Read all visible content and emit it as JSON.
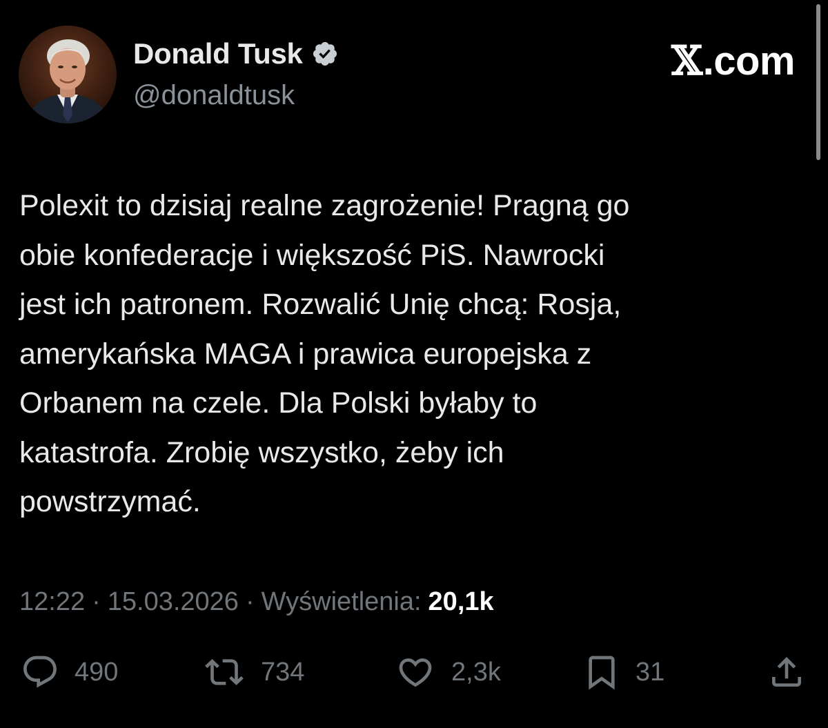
{
  "author": {
    "display_name": "Donald Tusk",
    "handle": "@donaldtusk",
    "verified_icon": "verified-badge-icon",
    "avatar": "profile-photo"
  },
  "brand": {
    "x_glyph": "𝕏",
    "domain": ".com"
  },
  "tweet": {
    "text": "Polexit to dzisiaj realne zagrożenie! Pragną go\nobie konfederacje i większość PiS. Nawrocki\njest ich patronem. Rozwalić Unię chcą: Rosja,\namerykańska MAGA i prawica europejska z\nOrbanem na czele. Dla Polski byłaby to\nkatastrofa. Zrobię wszystko, żeby ich\npowstrzymać."
  },
  "meta": {
    "time": "12:22",
    "separator": "·",
    "date": "15.03.2026",
    "views_label": "Wyświetlenia:",
    "views_count": "20,1k"
  },
  "actions": {
    "replies": {
      "icon": "reply-icon",
      "count": "490"
    },
    "reposts": {
      "icon": "repost-icon",
      "count": "734"
    },
    "likes": {
      "icon": "heart-icon",
      "count": "2,3k"
    },
    "bookmarks": {
      "icon": "bookmark-icon",
      "count": "31"
    },
    "share": {
      "icon": "share-icon"
    }
  },
  "colors": {
    "background": "#000000",
    "primary_text": "#e7e9ea",
    "secondary_text": "#71767b",
    "verified": "#c9ced3"
  }
}
